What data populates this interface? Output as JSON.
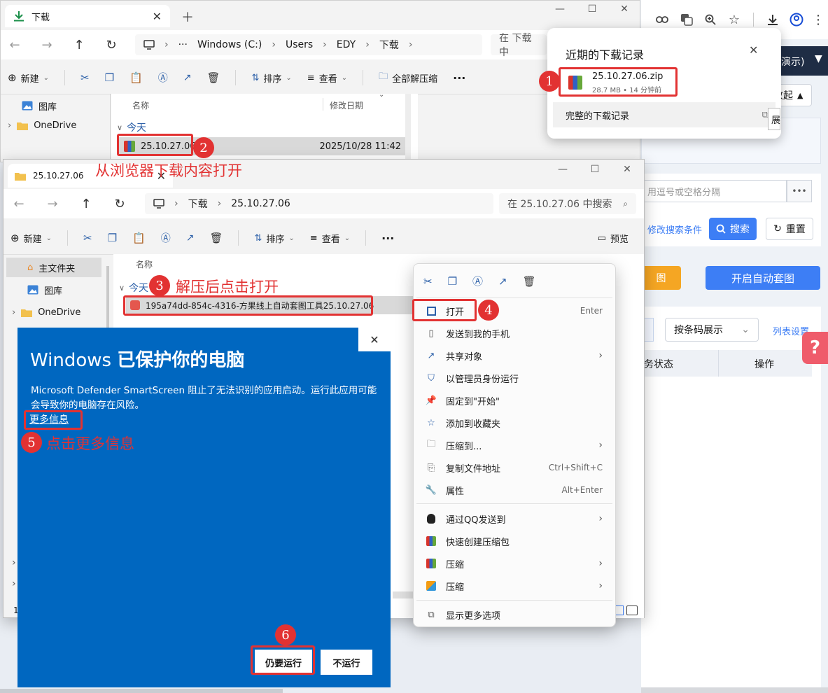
{
  "win1": {
    "tab_title": "下载",
    "address": [
      "Windows (C:)",
      "Users",
      "EDY",
      "下载"
    ],
    "search_placeholder": "在 下载 中",
    "toolbar": {
      "new": "新建",
      "sort": "排序",
      "view": "查看",
      "extract_all": "全部解压缩"
    },
    "sidebar": [
      "图库",
      "OneDrive"
    ],
    "col_name": "名称",
    "col_date": "修改日期",
    "group": "今天",
    "file_name": "25.10.27.06",
    "file_date": "2025/10/28 11:42"
  },
  "downloads": {
    "title": "近期的下载记录",
    "file": "25.10.27.06.zip",
    "meta": "28.7 MB • 14 分钟前",
    "full_history": "完整的下载记录",
    "tooltip": "展"
  },
  "webapp": {
    "header": "了演示)",
    "collapse": "收起",
    "input_placeholder": "用逗号或空格分隔",
    "more": "•••",
    "modify": "修改搜索条件",
    "search": "搜索",
    "reset": "重置",
    "btn_left": "图",
    "auto_btn": "开启自动套图",
    "select": "按条码展示",
    "list_settings": "列表设置",
    "col_status": "务状态",
    "col_action": "操作",
    "help": "?"
  },
  "win2": {
    "tab_title": "25.10.27.06",
    "address": [
      "下载",
      "25.10.27.06"
    ],
    "search_placeholder": "在 25.10.27.06 中搜索",
    "toolbar": {
      "new": "新建",
      "sort": "排序",
      "view": "查看",
      "preview": "预览"
    },
    "sidebar": [
      "主文件夹",
      "图库",
      "OneDrive"
    ],
    "col_name": "名称",
    "group": "今天",
    "file_name": "195a74dd-854c-4316-方果线上自动套图工具25.10.27.06",
    "status": "1"
  },
  "context_menu": {
    "items": [
      {
        "label": "打开",
        "shortcut": "Enter"
      },
      {
        "label": "发送到我的手机"
      },
      {
        "label": "共享对象"
      },
      {
        "label": "以管理员身份运行"
      },
      {
        "label": "固定到\"开始\""
      },
      {
        "label": "添加到收藏夹"
      },
      {
        "label": "压缩到..."
      },
      {
        "label": "复制文件地址",
        "shortcut": "Ctrl+Shift+C"
      },
      {
        "label": "属性",
        "shortcut": "Alt+Enter"
      },
      {
        "label": "通过QQ发送到"
      },
      {
        "label": "快速创建压缩包"
      },
      {
        "label": "压缩"
      },
      {
        "label": "压缩"
      },
      {
        "label": "显示更多选项"
      }
    ]
  },
  "smartscreen": {
    "title_prefix": "Windows ",
    "title_bold": "已保护你的电脑",
    "body": "Microsoft Defender SmartScreen 阻止了无法识别的应用启动。运行此应用可能会导致你的电脑存在风险。",
    "more_info": "更多信息",
    "run_anyway": "仍要运行",
    "dont_run": "不运行"
  },
  "annotations": {
    "steps": [
      "1",
      "2",
      "3",
      "4",
      "5",
      "6"
    ],
    "open_from_browser": "从浏览器下载内容打开",
    "unzip_then_open": "解压后点击打开",
    "click_more_info": "点击更多信息"
  },
  "colors": {
    "accent_red": "#e23232",
    "smartscreen_blue": "#0067c0",
    "primary_blue": "#3d7ef5",
    "orange": "#f5a623"
  }
}
